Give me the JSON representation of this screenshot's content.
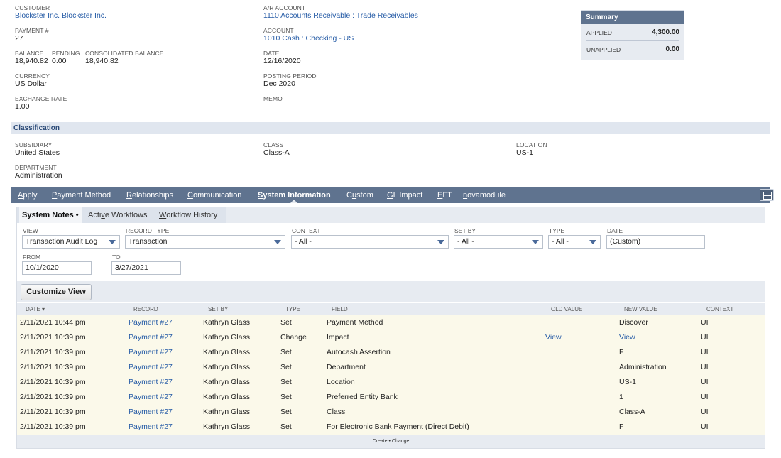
{
  "header": {
    "customer": {
      "label": "CUSTOMER",
      "value": "Blockster Inc. Blockster Inc."
    },
    "payment_no": {
      "label": "PAYMENT #",
      "value": "27"
    },
    "balance": {
      "label": "BALANCE",
      "value": "18,940.82"
    },
    "pending": {
      "label": "PENDING",
      "value": "0.00"
    },
    "consolidated_balance": {
      "label": "CONSOLIDATED BALANCE",
      "value": "18,940.82"
    },
    "currency": {
      "label": "CURRENCY",
      "value": "US Dollar"
    },
    "exchange_rate": {
      "label": "EXCHANGE RATE",
      "value": "1.00"
    },
    "ar_account": {
      "label": "A/R ACCOUNT",
      "value": "1110 Accounts Receivable : Trade Receivables"
    },
    "account": {
      "label": "ACCOUNT",
      "value": "1010 Cash : Checking - US"
    },
    "date": {
      "label": "DATE",
      "value": "12/16/2020"
    },
    "posting_period": {
      "label": "POSTING PERIOD",
      "value": "Dec 2020"
    },
    "memo": {
      "label": "MEMO",
      "value": ""
    }
  },
  "summary": {
    "title": "Summary",
    "applied_label": "APPLIED",
    "applied_value": "4,300.00",
    "unapplied_label": "UNAPPLIED",
    "unapplied_value": "0.00"
  },
  "classification": {
    "title": "Classification",
    "subsidiary": {
      "label": "SUBSIDIARY",
      "value": "United States"
    },
    "class": {
      "label": "CLASS",
      "value": "Class-A"
    },
    "location": {
      "label": "LOCATION",
      "value": "US-1"
    },
    "department": {
      "label": "DEPARTMENT",
      "value": "Administration"
    }
  },
  "tabs": [
    {
      "pre": "",
      "key": "A",
      "post": "pply"
    },
    {
      "pre": "",
      "key": "P",
      "post": "ayment Method"
    },
    {
      "pre": "",
      "key": "R",
      "post": "elationships"
    },
    {
      "pre": "",
      "key": "C",
      "post": "ommunication"
    },
    {
      "pre": "",
      "key": "S",
      "post": "ystem Information"
    },
    {
      "pre": "C",
      "key": "u",
      "post": "stom"
    },
    {
      "pre": "",
      "key": "G",
      "post": "L Impact"
    },
    {
      "pre": "",
      "key": "E",
      "post": "FT"
    },
    {
      "pre": "",
      "key": "n",
      "post": "ovamodule"
    }
  ],
  "subtabs": {
    "system_notes": "System Notes •",
    "active_workflows": {
      "pre": "Acti",
      "key": "v",
      "post": "e Workflows"
    },
    "workflow_history": {
      "pre": "",
      "key": "W",
      "post": "orkflow History"
    }
  },
  "filters": {
    "view": {
      "label": "VIEW",
      "value": "Transaction Audit Log"
    },
    "record_type": {
      "label": "RECORD TYPE",
      "value": "Transaction"
    },
    "context": {
      "label": "CONTEXT",
      "value": "- All -"
    },
    "set_by": {
      "label": "SET BY",
      "value": "- All -"
    },
    "type": {
      "label": "TYPE",
      "value": "- All -"
    },
    "date": {
      "label": "DATE",
      "value": "(Custom)"
    },
    "from": {
      "label": "FROM",
      "value": "10/1/2020"
    },
    "to": {
      "label": "TO",
      "value": "3/27/2021"
    }
  },
  "customize_button": "Customize View",
  "table": {
    "columns": [
      "DATE ▾",
      "RECORD",
      "SET BY",
      "TYPE",
      "FIELD",
      "OLD VALUE",
      "NEW VALUE",
      "CONTEXT"
    ],
    "rows": [
      {
        "date": "2/11/2021 10:44 pm",
        "record": "Payment #27",
        "set_by": "Kathryn Glass",
        "type": "Set",
        "field": "Payment Method",
        "old": "",
        "new": "Discover",
        "context": "UI"
      },
      {
        "date": "2/11/2021 10:39 pm",
        "record": "Payment #27",
        "set_by": "Kathryn Glass",
        "type": "Change",
        "field": "Impact",
        "old": "View",
        "new": "View",
        "context": "UI"
      },
      {
        "date": "2/11/2021 10:39 pm",
        "record": "Payment #27",
        "set_by": "Kathryn Glass",
        "type": "Set",
        "field": "Autocash Assertion",
        "old": "",
        "new": "F",
        "context": "UI"
      },
      {
        "date": "2/11/2021 10:39 pm",
        "record": "Payment #27",
        "set_by": "Kathryn Glass",
        "type": "Set",
        "field": "Department",
        "old": "",
        "new": "Administration",
        "context": "UI"
      },
      {
        "date": "2/11/2021 10:39 pm",
        "record": "Payment #27",
        "set_by": "Kathryn Glass",
        "type": "Set",
        "field": "Location",
        "old": "",
        "new": "US-1",
        "context": "UI"
      },
      {
        "date": "2/11/2021 10:39 pm",
        "record": "Payment #27",
        "set_by": "Kathryn Glass",
        "type": "Set",
        "field": "Preferred Entity Bank",
        "old": "",
        "new": "1",
        "context": "UI"
      },
      {
        "date": "2/11/2021 10:39 pm",
        "record": "Payment #27",
        "set_by": "Kathryn Glass",
        "type": "Set",
        "field": "Class",
        "old": "",
        "new": "Class-A",
        "context": "UI"
      },
      {
        "date": "2/11/2021 10:39 pm",
        "record": "Payment #27",
        "set_by": "Kathryn Glass",
        "type": "Set",
        "field": "For Electronic Bank Payment (Direct Debit)",
        "old": "",
        "new": "F",
        "context": "UI"
      }
    ]
  },
  "footer": "Create • Change",
  "colors": {
    "tab_bar": "#5f738f",
    "band": "#e0e6ef",
    "link": "#255ba6",
    "row_bg": "#fbf9ea"
  }
}
